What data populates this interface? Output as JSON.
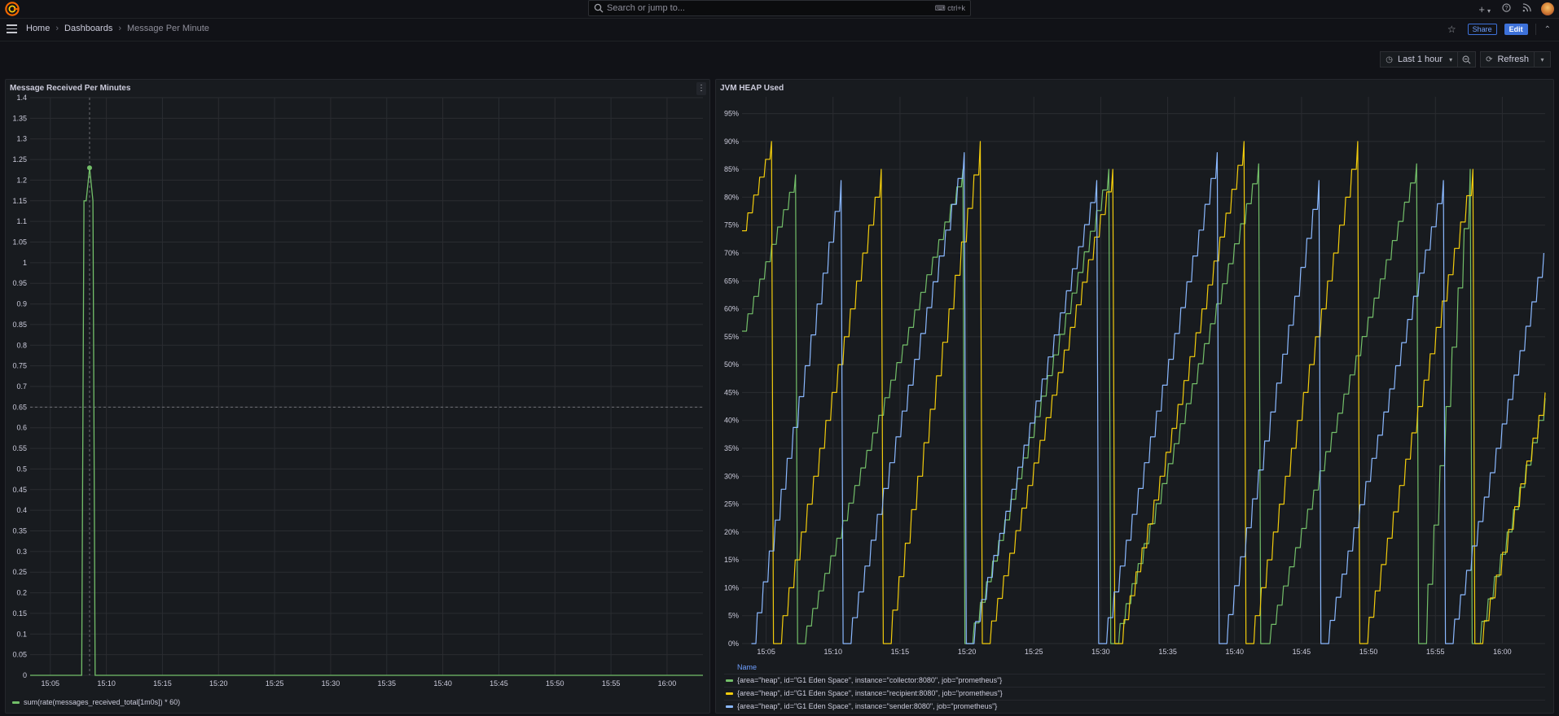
{
  "search": {
    "placeholder": "Search or jump to...",
    "shortcut": "ctrl+k"
  },
  "topbar": {
    "plus": "+",
    "plus_dropdown": "▾"
  },
  "breadcrumbs": [
    "Home",
    "Dashboards",
    "Message Per Minute"
  ],
  "nav": {
    "share_label": "Share",
    "edit_label": "Edit"
  },
  "time_picker": {
    "label": "Last 1 hour",
    "refresh_label": "Refresh"
  },
  "colors": {
    "green": "#73bf69",
    "yellow": "#f2cc0c",
    "blue": "#8ab8ff",
    "accent": "#3d71d9"
  },
  "panels": [
    {
      "title": "Message Received Per Minutes",
      "legend": [
        "sum(rate(messages_received_total[1m0s]) * 60)"
      ]
    },
    {
      "title": "JVM HEAP Used",
      "legend_header": "Name",
      "legend": [
        "{area=\"heap\", id=\"G1 Eden Space\", instance=\"collector:8080\", job=\"prometheus\"}",
        "{area=\"heap\", id=\"G1 Eden Space\", instance=\"recipient:8080\", job=\"prometheus\"}",
        "{area=\"heap\", id=\"G1 Eden Space\", instance=\"sender:8080\", job=\"prometheus\"}"
      ]
    }
  ],
  "chart_data": [
    {
      "type": "line",
      "title": "Message Received Per Minutes",
      "x_ticks": [
        "15:05",
        "15:10",
        "15:15",
        "15:20",
        "15:25",
        "15:30",
        "15:35",
        "15:40",
        "15:45",
        "15:50",
        "15:55",
        "16:00"
      ],
      "y_ticks": [
        "0",
        "0.05",
        "0.1",
        "0.15",
        "0.2",
        "0.25",
        "0.3",
        "0.35",
        "0.4",
        "0.45",
        "0.5",
        "0.55",
        "0.6",
        "0.65",
        "0.7",
        "0.75",
        "0.8",
        "0.85",
        "0.9",
        "0.95",
        "1",
        "1.05",
        "1.1",
        "1.15",
        "1.2",
        "1.25",
        "1.3",
        "1.35",
        "1.4"
      ],
      "ylim": [
        0,
        1.4
      ],
      "xlim_minutes": [
        3.2,
        63.2
      ],
      "crosshair": {
        "x_minutes": 8.5,
        "y": 0.65
      },
      "series": [
        {
          "name": "sum(rate(messages_received_total[1m0s]) * 60)",
          "color": "#73bf69",
          "x_minutes": [
            3.2,
            7.8,
            8.0,
            8.2,
            8.5,
            8.8,
            9.0,
            9.2,
            63.2
          ],
          "values": [
            0,
            0,
            1.15,
            1.15,
            1.23,
            1.15,
            0,
            0,
            0
          ],
          "highlight_point": {
            "x_minutes": 8.5,
            "value": 1.23
          }
        }
      ]
    },
    {
      "type": "line",
      "title": "JVM HEAP Used",
      "x_ticks": [
        "15:05",
        "15:10",
        "15:15",
        "15:20",
        "15:25",
        "15:30",
        "15:35",
        "15:40",
        "15:45",
        "15:50",
        "15:55",
        "16:00"
      ],
      "y_ticks": [
        "0%",
        "5%",
        "10%",
        "15%",
        "20%",
        "25%",
        "30%",
        "35%",
        "40%",
        "45%",
        "50%",
        "55%",
        "60%",
        "65%",
        "70%",
        "75%",
        "80%",
        "85%",
        "90%",
        "95%"
      ],
      "ylim": [
        0,
        98
      ],
      "xlim_minutes": [
        3.2,
        63.2
      ],
      "series": [
        {
          "name": "{area=\"heap\", id=\"G1 Eden Space\", instance=\"collector:8080\", job=\"prometheus\"}",
          "color": "#73bf69",
          "cycles": [
            [
              3.2,
              56,
              7.2,
              84
            ],
            [
              7.6,
              0,
              19.7,
              85
            ],
            [
              20.1,
              0,
              30.6,
              85
            ],
            [
              31.0,
              0,
              41.8,
              86
            ],
            [
              42.3,
              0,
              53.6,
              86
            ],
            [
              54.0,
              0,
              57.6,
              85
            ],
            [
              58.0,
              0,
              63.2,
              44
            ]
          ]
        },
        {
          "name": "{area=\"heap\", id=\"G1 Eden Space\", instance=\"recipient:8080\", job=\"prometheus\"}",
          "color": "#f2cc0c",
          "cycles": [
            [
              3.2,
              74,
              5.4,
              90
            ],
            [
              5.8,
              0,
              13.6,
              85
            ],
            [
              14.0,
              0,
              21.0,
              90
            ],
            [
              21.4,
              0,
              30.9,
              85
            ],
            [
              31.3,
              0,
              40.7,
              90
            ],
            [
              41.1,
              0,
              49.2,
              90
            ],
            [
              49.6,
              0,
              57.8,
              85
            ],
            [
              58.2,
              0,
              63.2,
              45
            ]
          ]
        },
        {
          "name": "{area=\"heap\", id=\"G1 Eden Space\", instance=\"sender:8080\", job=\"prometheus\"}",
          "color": "#8ab8ff",
          "cycles": [
            [
              3.9,
              0,
              10.6,
              83
            ],
            [
              11.0,
              0,
              19.8,
              88
            ],
            [
              20.2,
              0,
              29.7,
              83
            ],
            [
              30.1,
              0,
              38.7,
              88
            ],
            [
              39.1,
              0,
              46.3,
              83
            ],
            [
              46.7,
              0,
              55.6,
              83
            ],
            [
              56.0,
              0,
              63.1,
              70
            ]
          ]
        }
      ]
    }
  ]
}
